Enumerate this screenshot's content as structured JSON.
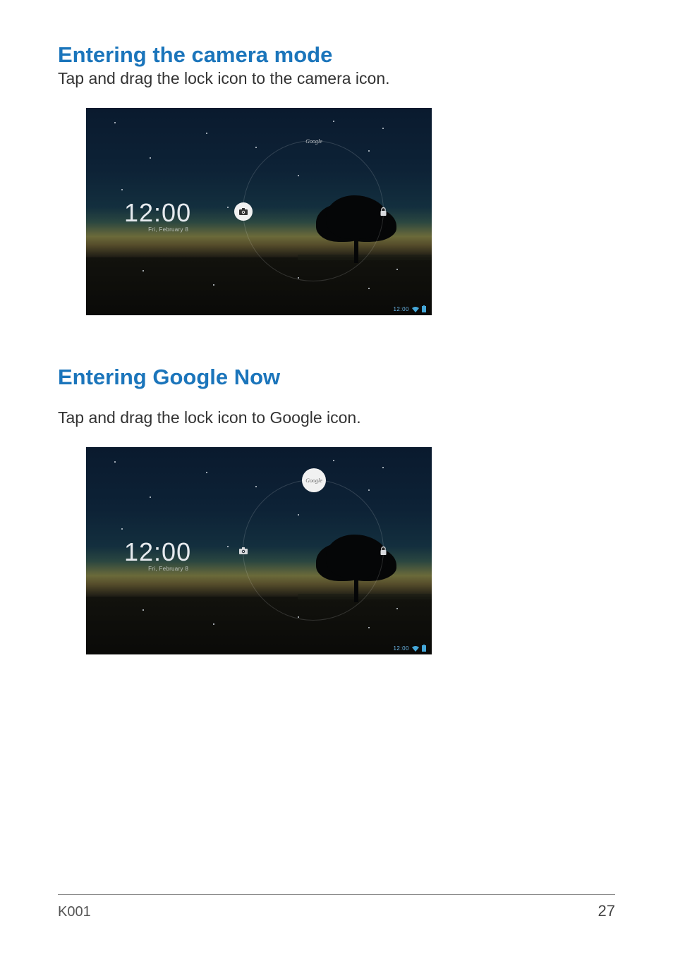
{
  "sections": [
    {
      "heading": "Entering the camera mode",
      "body": "Tap and drag the lock icon to the camera icon."
    },
    {
      "heading": "Entering Google Now",
      "body": "Tap and drag the lock icon to Google icon."
    }
  ],
  "lockscreen": {
    "time": "12:00",
    "date": "Fri, February 8",
    "google_label": "Google",
    "status_time": "12:00"
  },
  "icons": {
    "camera": "camera-icon",
    "lock": "lock-icon",
    "google": "google-icon",
    "wifi": "wifi-icon",
    "battery": "battery-icon"
  },
  "footer": {
    "model": "K001",
    "page": "27"
  }
}
